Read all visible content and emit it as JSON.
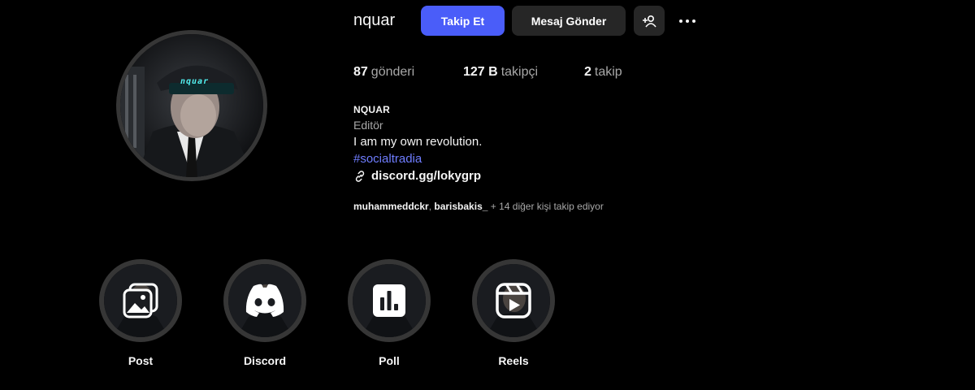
{
  "profile": {
    "username": "nquar",
    "follow_label": "Takip Et",
    "message_label": "Mesaj Gönder",
    "add_user_icon": "add-user-icon",
    "more_icon": "more-horizontal-icon",
    "avatar_cap_text": "nquar"
  },
  "stats": {
    "posts": {
      "value": "87",
      "label": "gönderi"
    },
    "followers": {
      "value": "127 B",
      "label": "takipçi"
    },
    "following": {
      "value": "2",
      "label": "takip"
    }
  },
  "bio": {
    "name": "NQUAR",
    "category": "Editör",
    "text": "I am my own revolution.",
    "hashtag": "#socialtradia",
    "link": "discord.gg/lokygrp",
    "link_icon": "link-icon"
  },
  "followed_by": {
    "users": "muhammeddckr",
    "separator": ", ",
    "users2": "barisbakis_",
    "rest": " + 14 diğer kişi takip ediyor"
  },
  "highlights": [
    {
      "label": "Post",
      "icon": "gallery-icon"
    },
    {
      "label": "Discord",
      "icon": "discord-icon"
    },
    {
      "label": "Poll",
      "icon": "bar-chart-icon"
    },
    {
      "label": "Reels",
      "icon": "reels-icon"
    }
  ],
  "colors": {
    "background": "#000000",
    "primary_button": "#4a5df9",
    "secondary_button": "#262626",
    "hashtag": "#6f7dff",
    "secondary_text": "#a8a8a8"
  }
}
